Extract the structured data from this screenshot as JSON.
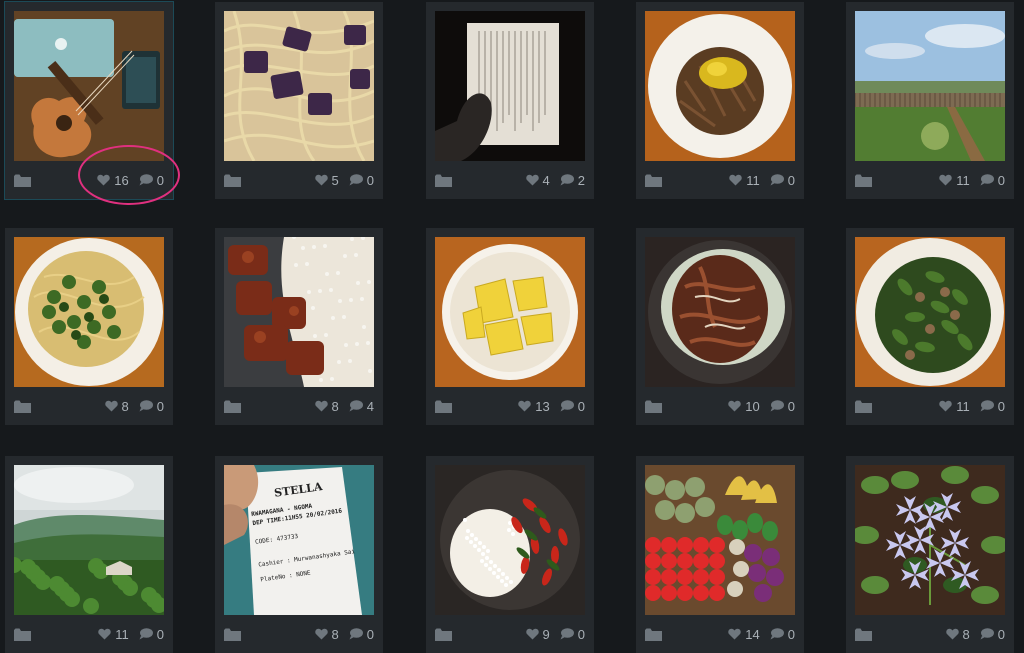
{
  "colors": {
    "background": "#16191c",
    "card": "#25292d",
    "icon": "#6f777e",
    "count_text": "#a9b0b6",
    "highlight": "#e0307f"
  },
  "icons": {
    "folder": "folder-icon",
    "likes": "heart-icon",
    "comments": "comment-bubble-icon"
  },
  "photos": [
    {
      "subject": "ukulele-laptop",
      "likes": "16",
      "comments": "0"
    },
    {
      "subject": "spaghetti",
      "likes": "5",
      "comments": "0"
    },
    {
      "subject": "book-page",
      "likes": "4",
      "comments": "2"
    },
    {
      "subject": "plate-meal",
      "likes": "11",
      "comments": "0"
    },
    {
      "subject": "landscape",
      "likes": "11",
      "comments": "0"
    },
    {
      "subject": "pasta-greens",
      "likes": "8",
      "comments": "0"
    },
    {
      "subject": "meat-rice",
      "likes": "8",
      "comments": "4"
    },
    {
      "subject": "pineapple",
      "likes": "13",
      "comments": "0"
    },
    {
      "subject": "stir-fry",
      "likes": "10",
      "comments": "0"
    },
    {
      "subject": "greens-stew",
      "likes": "11",
      "comments": "0"
    },
    {
      "subject": "hills",
      "likes": "11",
      "comments": "0"
    },
    {
      "subject": "bus-ticket",
      "likes": "8",
      "comments": "0"
    },
    {
      "subject": "rice-peppers",
      "likes": "9",
      "comments": "0"
    },
    {
      "subject": "market-produce",
      "likes": "14",
      "comments": "0"
    },
    {
      "subject": "blue-flowers",
      "likes": "8",
      "comments": "0"
    }
  ],
  "ticket": {
    "brand": "STELLA",
    "route": "RWAMAGANA - NGOMA",
    "dep_time": "DEP TIME:11H55 20/02/2016",
    "code": "CODE: 473733",
    "cashier": "Cashier : Murwanashyaka Sai",
    "plate": "PlateNo : NONE"
  }
}
